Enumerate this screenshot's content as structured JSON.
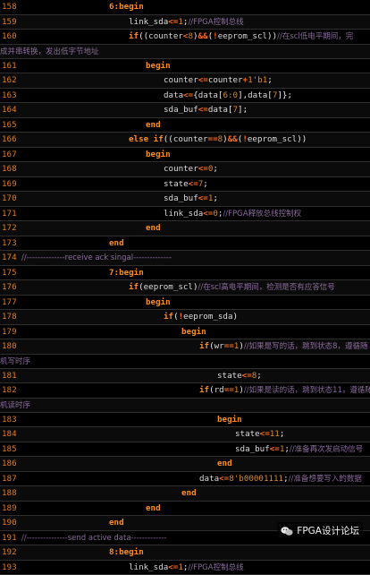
{
  "watermark": "FPGA设计论坛",
  "lines": [
    {
      "n": "158",
      "indent": 122,
      "parts": [
        [
          "kw",
          "6:begin"
        ]
      ]
    },
    {
      "n": "159",
      "indent": 144,
      "parts": [
        [
          "id",
          "link_sda"
        ],
        [
          "op",
          "<="
        ],
        [
          "num",
          "1"
        ],
        [
          "pu",
          ";"
        ],
        [
          "cm",
          "//FPGA控制总线"
        ]
      ]
    },
    {
      "n": "160",
      "indent": 144,
      "parts": [
        [
          "kw",
          "if"
        ],
        [
          "pu",
          "(("
        ],
        [
          "id",
          "counter"
        ],
        [
          "op",
          "<"
        ],
        [
          "num",
          "8"
        ],
        [
          "pu",
          ")"
        ],
        [
          "op",
          "&&"
        ],
        [
          "pu",
          "("
        ],
        [
          "op",
          "!"
        ],
        [
          "id",
          "eeprom_scl"
        ],
        [
          "pu",
          "))"
        ],
        [
          "cm",
          "//在scl低电平期间，完"
        ]
      ]
    },
    {
      "n": "",
      "indent": 0,
      "wrap": true,
      "parts": [
        [
          "cm",
          "成并串转换，发出低字节地址"
        ]
      ]
    },
    {
      "n": "161",
      "indent": 163,
      "parts": [
        [
          "kw",
          "begin"
        ]
      ]
    },
    {
      "n": "162",
      "indent": 183,
      "parts": [
        [
          "id",
          "counter"
        ],
        [
          "op",
          "<="
        ],
        [
          "id",
          "counter"
        ],
        [
          "op",
          "+"
        ],
        [
          "num",
          "1'b1"
        ],
        [
          "pu",
          ";"
        ]
      ]
    },
    {
      "n": "163",
      "indent": 183,
      "parts": [
        [
          "id",
          "data"
        ],
        [
          "op",
          "<="
        ],
        [
          "pu",
          "{"
        ],
        [
          "id",
          "data"
        ],
        [
          "pu",
          "["
        ],
        [
          "num",
          "6:0"
        ],
        [
          "pu",
          "],"
        ],
        [
          "id",
          "data"
        ],
        [
          "pu",
          "["
        ],
        [
          "num",
          "7"
        ],
        [
          "pu",
          "]};"
        ]
      ]
    },
    {
      "n": "164",
      "indent": 183,
      "parts": [
        [
          "id",
          "sda_buf"
        ],
        [
          "op",
          "<="
        ],
        [
          "id",
          "data"
        ],
        [
          "pu",
          "["
        ],
        [
          "num",
          "7"
        ],
        [
          "pu",
          "];"
        ]
      ]
    },
    {
      "n": "165",
      "indent": 163,
      "parts": [
        [
          "kw",
          "end"
        ]
      ]
    },
    {
      "n": "166",
      "indent": 144,
      "parts": [
        [
          "kw",
          "else if"
        ],
        [
          "pu",
          "(("
        ],
        [
          "id",
          "counter"
        ],
        [
          "op",
          "=="
        ],
        [
          "num",
          "8"
        ],
        [
          "pu",
          ")"
        ],
        [
          "op",
          "&&"
        ],
        [
          "pu",
          "("
        ],
        [
          "op",
          "!"
        ],
        [
          "id",
          "eeprom_scl"
        ],
        [
          "pu",
          "))"
        ]
      ]
    },
    {
      "n": "167",
      "indent": 163,
      "parts": [
        [
          "kw",
          "begin"
        ]
      ]
    },
    {
      "n": "168",
      "indent": 183,
      "parts": [
        [
          "id",
          "counter"
        ],
        [
          "op",
          "<="
        ],
        [
          "num",
          "0"
        ],
        [
          "pu",
          ";"
        ]
      ]
    },
    {
      "n": "169",
      "indent": 183,
      "parts": [
        [
          "id",
          "state"
        ],
        [
          "op",
          "<="
        ],
        [
          "num",
          "7"
        ],
        [
          "pu",
          ";"
        ]
      ]
    },
    {
      "n": "170",
      "indent": 183,
      "parts": [
        [
          "id",
          "sda_buf"
        ],
        [
          "op",
          "<="
        ],
        [
          "num",
          "1"
        ],
        [
          "pu",
          ";"
        ]
      ]
    },
    {
      "n": "171",
      "indent": 183,
      "parts": [
        [
          "id",
          "link_sda"
        ],
        [
          "op",
          "<="
        ],
        [
          "num",
          "0"
        ],
        [
          "pu",
          ";"
        ],
        [
          "cm",
          "//FPGA释放总线控制权"
        ]
      ]
    },
    {
      "n": "172",
      "indent": 163,
      "parts": [
        [
          "kw",
          "end"
        ]
      ]
    },
    {
      "n": "173",
      "indent": 122,
      "parts": [
        [
          "kw",
          "end"
        ]
      ]
    },
    {
      "n": "174",
      "indent": 24,
      "parts": [
        [
          "cm",
          "//--------------receive ack singal--------------"
        ]
      ]
    },
    {
      "n": "175",
      "indent": 122,
      "parts": [
        [
          "kw",
          "7:begin"
        ]
      ]
    },
    {
      "n": "176",
      "indent": 144,
      "parts": [
        [
          "kw",
          "if"
        ],
        [
          "pu",
          "("
        ],
        [
          "id",
          "eeprom_scl"
        ],
        [
          "pu",
          ")"
        ],
        [
          "cm",
          "//在scl高电平期间，检测是否有应答信号"
        ]
      ]
    },
    {
      "n": "177",
      "indent": 163,
      "parts": [
        [
          "kw",
          "begin"
        ]
      ]
    },
    {
      "n": "178",
      "indent": 183,
      "parts": [
        [
          "kw",
          "if"
        ],
        [
          "pu",
          "("
        ],
        [
          "op",
          "!"
        ],
        [
          "id",
          "eeprom_sda"
        ],
        [
          "pu",
          ")"
        ]
      ]
    },
    {
      "n": "179",
      "indent": 203,
      "parts": [
        [
          "kw",
          "begin"
        ]
      ]
    },
    {
      "n": "180",
      "indent": 223,
      "parts": [
        [
          "kw",
          "if"
        ],
        [
          "pu",
          "("
        ],
        [
          "id",
          "wr"
        ],
        [
          "op",
          "=="
        ],
        [
          "num",
          "1"
        ],
        [
          "pu",
          ")"
        ],
        [
          "cm",
          "//如果是写的话，跳到状态8，遵循随"
        ]
      ]
    },
    {
      "n": "",
      "indent": 0,
      "wrap": true,
      "parts": [
        [
          "cm",
          "机写时序"
        ]
      ]
    },
    {
      "n": "181",
      "indent": 243,
      "parts": [
        [
          "id",
          "state"
        ],
        [
          "op",
          "<="
        ],
        [
          "num",
          "8"
        ],
        [
          "pu",
          ";"
        ]
      ]
    },
    {
      "n": "182",
      "indent": 223,
      "parts": [
        [
          "kw",
          "if"
        ],
        [
          "pu",
          "("
        ],
        [
          "id",
          "rd"
        ],
        [
          "op",
          "=="
        ],
        [
          "num",
          "1"
        ],
        [
          "pu",
          ")"
        ],
        [
          "cm",
          "//如果是读的话，跳到状态11，遵循随"
        ]
      ]
    },
    {
      "n": "",
      "indent": 0,
      "wrap": true,
      "parts": [
        [
          "cm",
          "机读时序"
        ]
      ]
    },
    {
      "n": "183",
      "indent": 243,
      "parts": [
        [
          "kw",
          "begin"
        ]
      ]
    },
    {
      "n": "184",
      "indent": 263,
      "parts": [
        [
          "id",
          "state"
        ],
        [
          "op",
          "<="
        ],
        [
          "num",
          "11"
        ],
        [
          "pu",
          ";"
        ]
      ]
    },
    {
      "n": "185",
      "indent": 263,
      "parts": [
        [
          "id",
          "sda_buf"
        ],
        [
          "op",
          "<="
        ],
        [
          "num",
          "1"
        ],
        [
          "pu",
          ";"
        ],
        [
          "cm",
          "//准备再次发启动信号"
        ]
      ]
    },
    {
      "n": "186",
      "indent": 243,
      "parts": [
        [
          "kw",
          "end"
        ]
      ]
    },
    {
      "n": "187",
      "indent": 223,
      "parts": [
        [
          "id",
          "data"
        ],
        [
          "op",
          "<="
        ],
        [
          "num",
          "8'b00001111"
        ],
        [
          "pu",
          ";"
        ],
        [
          "cm",
          "//准备想要写入的数据"
        ]
      ]
    },
    {
      "n": "188",
      "indent": 203,
      "parts": [
        [
          "kw",
          "end"
        ]
      ]
    },
    {
      "n": "189",
      "indent": 163,
      "parts": [
        [
          "kw",
          "end"
        ]
      ]
    },
    {
      "n": "190",
      "indent": 122,
      "parts": [
        [
          "kw",
          "end"
        ]
      ]
    },
    {
      "n": "191",
      "indent": 24,
      "parts": [
        [
          "cm",
          "//---------------send active data-------------"
        ]
      ]
    },
    {
      "n": "192",
      "indent": 122,
      "parts": [
        [
          "kw",
          "8:begin"
        ]
      ]
    },
    {
      "n": "193",
      "indent": 144,
      "parts": [
        [
          "id",
          "link_sda"
        ],
        [
          "op",
          "<="
        ],
        [
          "num",
          "1"
        ],
        [
          "pu",
          ";"
        ],
        [
          "cm",
          "//FPGA控制总线"
        ]
      ]
    }
  ]
}
